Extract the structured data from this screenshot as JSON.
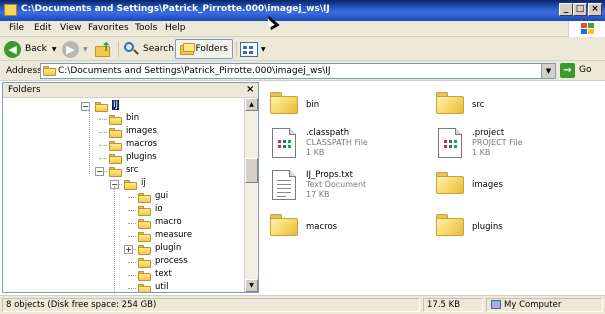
{
  "window": {
    "title": "C:\\Documents and Settings\\Patrick_Pirrotte.000\\imagej_ws\\IJ",
    "controls": {
      "minimize": "_",
      "maximize": "□",
      "close": "×"
    }
  },
  "menubar": {
    "items": [
      "File",
      "Edit",
      "View",
      "Favorites",
      "Tools",
      "Help"
    ]
  },
  "toolbar": {
    "back_label": "Back",
    "search_label": "Search",
    "folders_label": "Folders",
    "back_icon": "back-arrow-icon",
    "forward_icon": "forward-arrow-icon",
    "up_icon": "folder-up-icon",
    "search_icon": "magnifier-icon",
    "views_icon": "views-grid-icon"
  },
  "address": {
    "label": "Address",
    "value": "C:\\Documents and Settings\\Patrick_Pirrotte.000\\imagej_ws\\IJ",
    "go_label": "Go"
  },
  "folders_pane": {
    "title": "Folders",
    "close": "×",
    "tree": [
      {
        "label": "IJ",
        "level": 0,
        "expander": "−",
        "selected": true
      },
      {
        "label": "bin",
        "level": 1,
        "expander": ""
      },
      {
        "label": "images",
        "level": 1,
        "expander": ""
      },
      {
        "label": "macros",
        "level": 1,
        "expander": ""
      },
      {
        "label": "plugins",
        "level": 1,
        "expander": ""
      },
      {
        "label": "src",
        "level": 1,
        "expander": "−"
      },
      {
        "label": "ij",
        "level": 2,
        "expander": "−"
      },
      {
        "label": "gui",
        "level": 3,
        "expander": ""
      },
      {
        "label": "io",
        "level": 3,
        "expander": ""
      },
      {
        "label": "macro",
        "level": 3,
        "expander": ""
      },
      {
        "label": "measure",
        "level": 3,
        "expander": ""
      },
      {
        "label": "plugin",
        "level": 3,
        "expander": "+"
      },
      {
        "label": "process",
        "level": 3,
        "expander": ""
      },
      {
        "label": "text",
        "level": 3,
        "expander": ""
      },
      {
        "label": "util",
        "level": 3,
        "expander": ""
      }
    ]
  },
  "items": [
    {
      "name": "bin",
      "kind": "folder",
      "type": "",
      "size": ""
    },
    {
      "name": "src",
      "kind": "folder",
      "type": "",
      "size": ""
    },
    {
      "name": ".classpath",
      "kind": "file-classpath",
      "type": "CLASSPATH File",
      "size": "1 KB"
    },
    {
      "name": ".project",
      "kind": "file-project",
      "type": "PROJECT File",
      "size": "1 KB"
    },
    {
      "name": "IJ_Props.txt",
      "kind": "file-text",
      "type": "Text Document",
      "size": "17 KB"
    },
    {
      "name": "images",
      "kind": "folder",
      "type": "",
      "size": ""
    },
    {
      "name": "macros",
      "kind": "folder",
      "type": "",
      "size": ""
    },
    {
      "name": "plugins",
      "kind": "folder",
      "type": "",
      "size": ""
    }
  ],
  "statusbar": {
    "objects": "8 objects (Disk free space: 254 GB)",
    "size": "17.5 KB",
    "location": "My Computer"
  },
  "colors": {
    "titlebar": "#0a246a",
    "chrome": "#ece9d8",
    "selection": "#0a246a",
    "folder": "#f7d86a"
  }
}
